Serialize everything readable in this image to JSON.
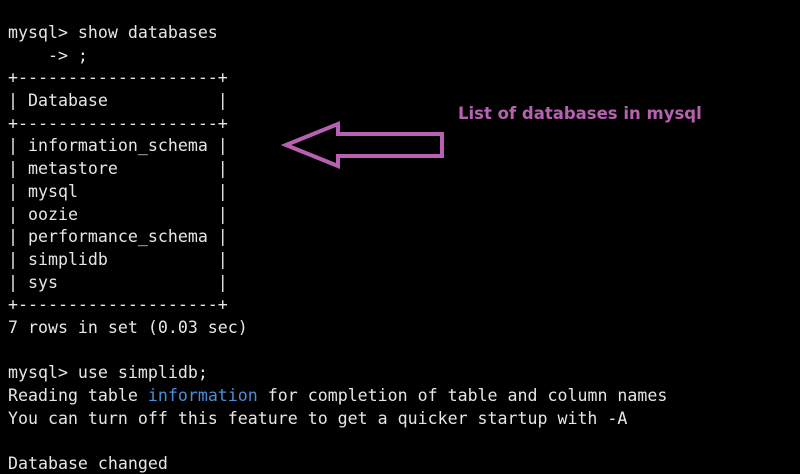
{
  "terminal": {
    "background": "#000000",
    "text_color": "#e6e6e6",
    "highlight_color": "#4a8fd8",
    "lines": {
      "prompt1": "mysql> show databases",
      "continuation": "    -> ;",
      "border_top": "+--------------------+",
      "header": "| Database           |",
      "border_mid": "+--------------------+",
      "rows": [
        "| information_schema |",
        "| metastore          |",
        "| mysql              |",
        "| oozie              |",
        "| performance_schema |",
        "| simplidb           |",
        "| sys                |"
      ],
      "border_bottom": "+--------------------+",
      "row_count": "7 rows in set (0.03 sec)",
      "prompt2": "mysql> use simplidb;",
      "reading_before": "Reading table ",
      "reading_highlight": "information",
      "reading_after": " for completion of table and column names",
      "turn_off": "You can turn off this feature to get a quicker startup with -A",
      "changed": "Database changed"
    }
  },
  "annotation": {
    "text": "List of databases in mysql",
    "color": "#b860b2",
    "arrow_icon": "left-arrow-icon"
  }
}
